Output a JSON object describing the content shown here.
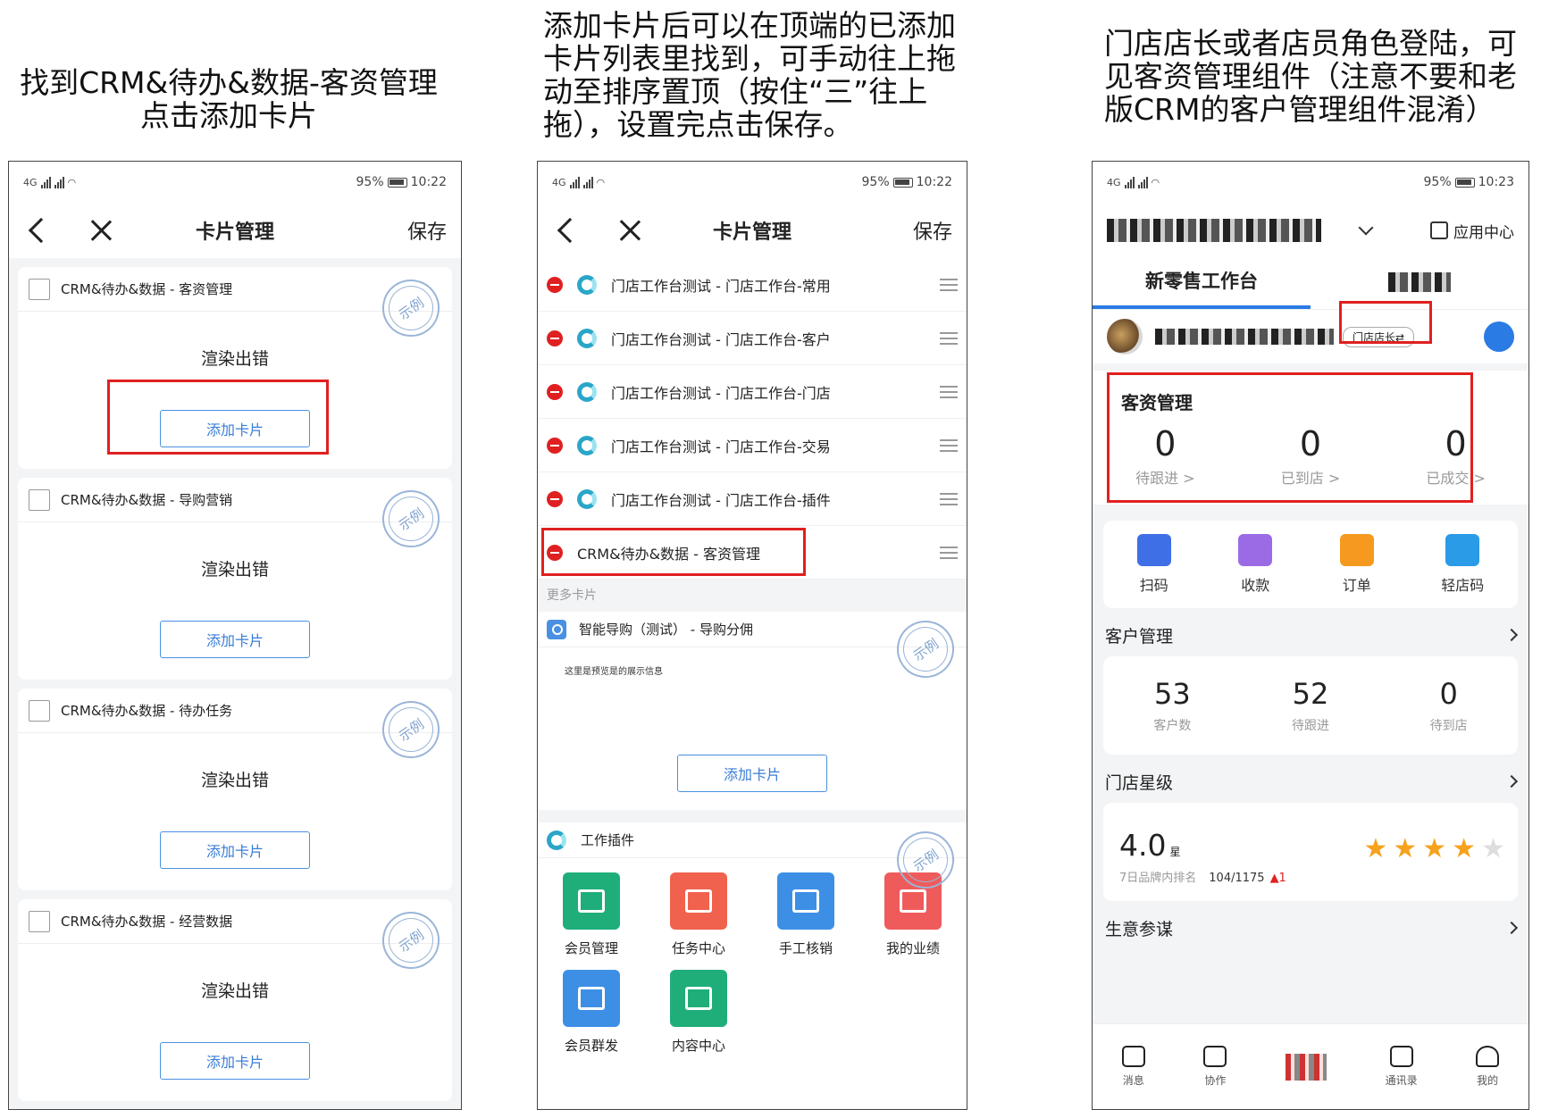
{
  "captions": {
    "step1_line1": "找到CRM&待办&数据-客资管理",
    "step1_line2": "点击添加卡片",
    "step2": "添加卡片后可以在顶端的已添加卡片列表里找到，可手动往上拖动至排序置顶（按住“三”往上拖），设置完点击保存。",
    "step3": "门店店长或者店员角色登陆，可见客资管理组件（注意不要和老版CRM的客户管理组件混淆）"
  },
  "status_bar": {
    "battery": "95%",
    "time_a": "10:22",
    "time_b": "10:23",
    "signal_label": "4G"
  },
  "panel1": {
    "title": "卡片管理",
    "save": "保存",
    "render_error": "渲染出错",
    "add_card": "添加卡片",
    "stamp": "示例",
    "cards": [
      {
        "name": "CRM&待办&数据 - 客资管理"
      },
      {
        "name": "CRM&待办&数据 - 导购营销"
      },
      {
        "name": "CRM&待办&数据 - 待办任务"
      },
      {
        "name": "CRM&待办&数据 - 经营数据"
      }
    ]
  },
  "panel2": {
    "title": "卡片管理",
    "save": "保存",
    "added": [
      "门店工作台测试 - 门店工作台-常用",
      "门店工作台测试 - 门店工作台-客户",
      "门店工作台测试 - 门店工作台-门店",
      "门店工作台测试 - 门店工作台-交易",
      "门店工作台测试 - 门店工作台-插件",
      "CRM&待办&数据 - 客资管理"
    ],
    "more_label": "更多卡片",
    "more_card": "智能导购（测试） - 导购分佣",
    "more_tip": "这里是预览是的展示信息",
    "add_card": "添加卡片",
    "stamp": "示例",
    "plugin_title": "工作插件",
    "plugins": [
      {
        "label": "会员管理",
        "color": "#1fae7a"
      },
      {
        "label": "任务中心",
        "color": "#f0624e"
      },
      {
        "label": "手工核销",
        "color": "#3d8fe6"
      },
      {
        "label": "我的业绩",
        "color": "#ef5b5b"
      },
      {
        "label": "会员群发",
        "color": "#3d8fe6"
      },
      {
        "label": "内容中心",
        "color": "#1fae7a"
      }
    ]
  },
  "panel3": {
    "app_center": "应用中心",
    "tab_active": "新零售工作台",
    "role": "门店店长⇄",
    "kezi_title": "客资管理",
    "kezi_stats": [
      {
        "value": "0",
        "label": "待跟进 >"
      },
      {
        "value": "0",
        "label": "已到店 >"
      },
      {
        "value": "0",
        "label": "已成交 >"
      }
    ],
    "tools": [
      {
        "label": "扫码",
        "color": "#3f6fe6"
      },
      {
        "label": "收款",
        "color": "#9b6be6"
      },
      {
        "label": "订单",
        "color": "#f59a1e"
      },
      {
        "label": "轻店码",
        "color": "#2a9be6"
      }
    ],
    "cust_title": "客户管理",
    "cust_stats": [
      {
        "value": "53",
        "label": "客户数"
      },
      {
        "value": "52",
        "label": "待跟进"
      },
      {
        "value": "0",
        "label": "待到店"
      }
    ],
    "star_title": "门店星级",
    "score": "4.0",
    "score_unit": "星",
    "rank_label": "7日品牌内排名",
    "rank_value": "104/1175",
    "rank_change": "▲1",
    "star_rating": 4,
    "advice_title": "生意参谋",
    "tabbar": [
      "消息",
      "协作",
      "",
      "通讯录",
      "我的"
    ]
  }
}
